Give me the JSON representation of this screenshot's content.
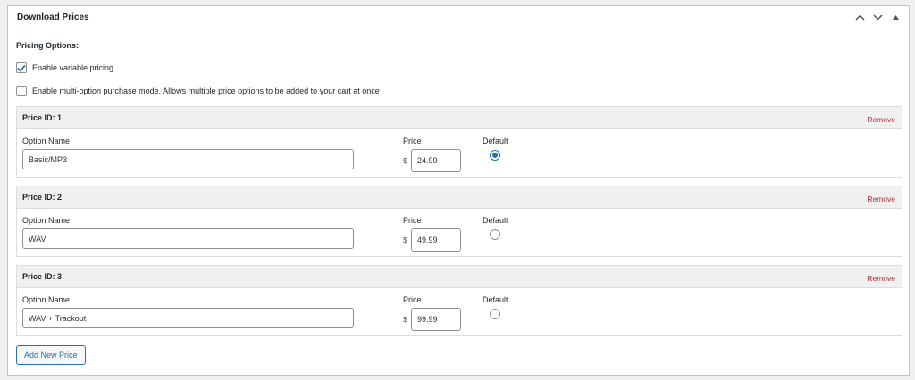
{
  "metabox": {
    "title": "Download Prices",
    "controls": {
      "move_up_icon": "chevron-up-icon",
      "move_down_icon": "chevron-down-icon",
      "toggle_icon": "caret-up-icon"
    }
  },
  "pricing_options": {
    "label": "Pricing Options:",
    "variable_pricing": {
      "label": "Enable variable pricing",
      "checked": true
    },
    "multi_option": {
      "label": "Enable multi-option purchase mode. Allows multiple price options to be added to your cart at once",
      "checked": false
    }
  },
  "field_labels": {
    "option_name": "Option Name",
    "price": "Price",
    "default": "Default",
    "currency": "$",
    "remove": "Remove"
  },
  "prices": [
    {
      "id_label": "Price ID: 1",
      "option_name": "Basic/MP3",
      "price": "24.99",
      "is_default": true
    },
    {
      "id_label": "Price ID: 2",
      "option_name": "WAV",
      "price": "49.99",
      "is_default": false
    },
    {
      "id_label": "Price ID: 3",
      "option_name": "WAV + Trackout",
      "price": "99.99",
      "is_default": false
    }
  ],
  "add_new_price_label": "Add New Price",
  "colors": {
    "accent": "#2271b1",
    "remove": "#b32d2e",
    "row_header_bg": "#f0f0f1"
  }
}
